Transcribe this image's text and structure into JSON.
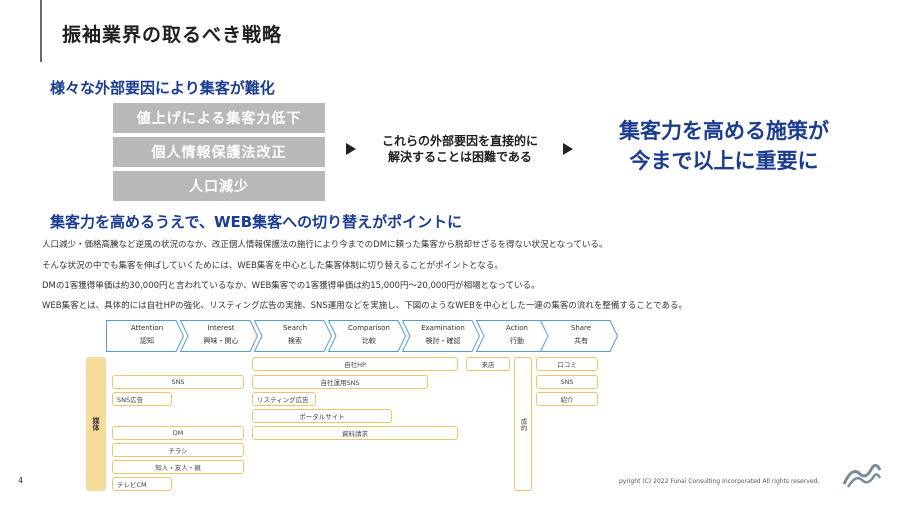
{
  "page": {
    "title": "振袖業界の取るべき戦略",
    "number": "4",
    "copyright": "pyright  (C) 2022 Funai Consulting  Incorporated  All rights  reserved."
  },
  "section1": {
    "heading": "様々な外部要因により集客が難化",
    "factors": [
      "値上げによる集客力低下",
      "個人情報保護法改正",
      "人口減少"
    ],
    "middle_text": [
      "これらの外部要因を直接的に",
      "解決することは困難である"
    ],
    "result": [
      "集客力を高める施策が",
      "今まで以上に重要に"
    ]
  },
  "section2": {
    "heading": "集客力を高めるうえで、WEB集客への切り替えがポイントに",
    "paragraphs": [
      "人口減少・価格高騰など逆風の状況のなか、改正個人情報保護法の施行により今までのDMに頼った集客から脱却せざるを得ない状況となっている。",
      "そんな状況の中でも集客を伸ばしていくためには、WEB集客を中心とした集客体制に切り替えることがポイントとなる。",
      "DMの1客獲得単価は約30,000円と言われているなか、WEB集客での1客獲得単価は約15,000円～20,000円が相場となっている。",
      "WEB集客とは、具体的には自社HPの強化、リスティング広告の実施、SNS運用などを実施し、下図のようなWEBを中心とした一連の集客の流れを整備することである。"
    ]
  },
  "flow": {
    "stages": [
      {
        "en": "Attention",
        "jp": "認知"
      },
      {
        "en": "Interest",
        "jp": "興味・関心"
      },
      {
        "en": "Search",
        "jp": "検索"
      },
      {
        "en": "Comparison",
        "jp": "比較"
      },
      {
        "en": "Examination",
        "jp": "検討・確認"
      },
      {
        "en": "Action",
        "jp": "行動"
      },
      {
        "en": "Share",
        "jp": "共有"
      }
    ],
    "stage_colors": {
      "fill": "#ffffff",
      "stroke": "#5b9bd5"
    }
  },
  "media": {
    "label": "媒体",
    "boxes": {
      "own_hp": "自社HP",
      "own_sns": "自社運用SNS",
      "listing": "リスティング広告",
      "portal": "ポータルサイト",
      "catalog": "資料請求",
      "sns": "SNS",
      "sns_ad": "SNS広告",
      "dm": "DM",
      "flyer": "チラシ",
      "referral": "知人・友人・親",
      "tvcm": "テレビCM",
      "visit": "来店",
      "contract": "成約",
      "review": "口コミ",
      "share_sns": "SNS",
      "introduce": "紹介"
    },
    "colors": {
      "box_border": "#f0c46b",
      "media_bar": "#f6dc9b"
    }
  },
  "colors": {
    "accent": "#1b3c8f",
    "factor_bg": "#b8b8b8"
  }
}
